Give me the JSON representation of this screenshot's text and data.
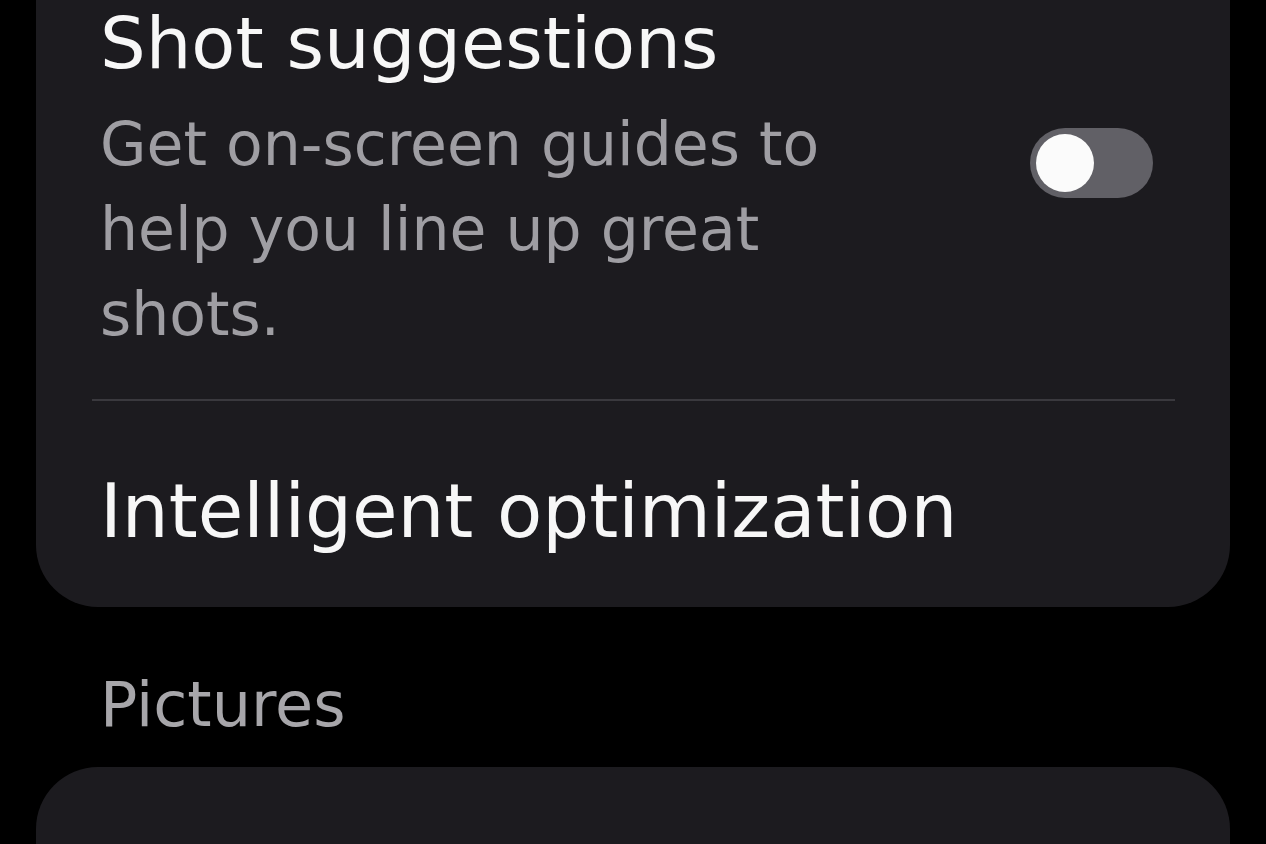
{
  "settings_card": {
    "items": [
      {
        "kind": "toggle",
        "title": "Shot suggestions",
        "description": "Get on-screen guides to help you line up great shots.",
        "on": false
      },
      {
        "kind": "link",
        "title": "Intelligent optimization"
      }
    ]
  },
  "section_header": "Pictures"
}
